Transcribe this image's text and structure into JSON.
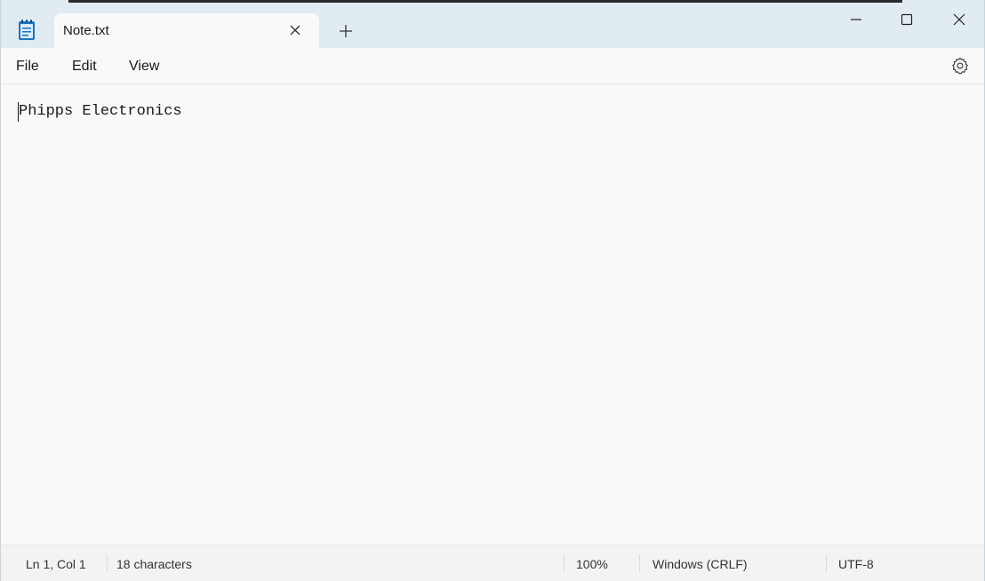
{
  "window": {
    "tab_title": "Note.txt",
    "icons": {
      "app": "notepad-icon",
      "tab_close": "close-icon",
      "new_tab": "plus-icon",
      "minimize": "minimize-icon",
      "maximize": "maximize-icon",
      "close": "close-icon",
      "settings": "gear-icon"
    }
  },
  "menu": {
    "file": "File",
    "edit": "Edit",
    "view": "View"
  },
  "editor": {
    "content": "Phipps Electronics"
  },
  "status": {
    "position": "Ln 1, Col 1",
    "characters": "18 characters",
    "zoom": "100%",
    "line_endings": "Windows (CRLF)",
    "encoding": "UTF-8"
  },
  "colors": {
    "titlebar": "#e1ebf2",
    "editor_bg": "#f9f9f9",
    "statusbar": "#f3f3f3",
    "icon_blue": "#1e73be"
  }
}
